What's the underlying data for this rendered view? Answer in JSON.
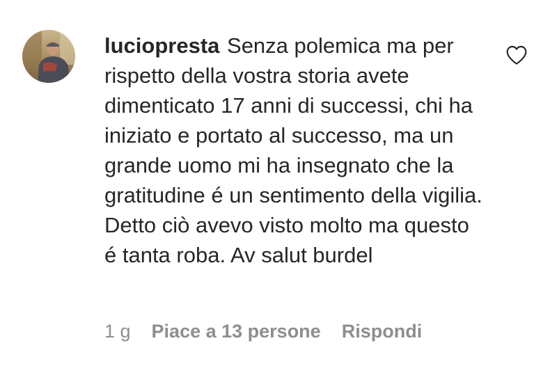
{
  "comment": {
    "username": "luciopresta",
    "text": "Senza polemica ma per rispetto della vostra storia avete dimenticato 17 anni di successi, chi ha iniziato e portato al successo, ma un grande uomo mi ha insegnato che la gratitudine é un sentimento della vigilia. Detto ciò avevo visto molto ma questo é tanta roba. Av salut burdel",
    "time": "1 g",
    "likes_label": "Piace a 13 persone",
    "reply_label": "Rispondi",
    "like_icon": "heart-outline-icon"
  },
  "colors": {
    "text": "#262626",
    "secondary": "#8e8e8e",
    "background": "#ffffff"
  }
}
